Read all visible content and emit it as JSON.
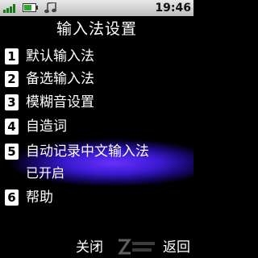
{
  "status_bar": {
    "time": "19:46",
    "icons": [
      "signal-icon",
      "battery-icon",
      "music-note-icon"
    ]
  },
  "title": "输入法设置",
  "menu": {
    "items": [
      {
        "number": "1",
        "label": "默认输入法"
      },
      {
        "number": "2",
        "label": "备选输入法"
      },
      {
        "number": "3",
        "label": "模糊音设置"
      },
      {
        "number": "4",
        "label": "自造词"
      },
      {
        "number": "5",
        "label": "自动记录中文输入法",
        "sub_label": "已开启",
        "selected": true
      },
      {
        "number": "6",
        "label": "帮助"
      }
    ]
  },
  "softkeys": {
    "left": "关闭",
    "right": "返回"
  },
  "colors": {
    "highlight": "#3a1ad0",
    "status_bar": "#d0d0d0"
  }
}
